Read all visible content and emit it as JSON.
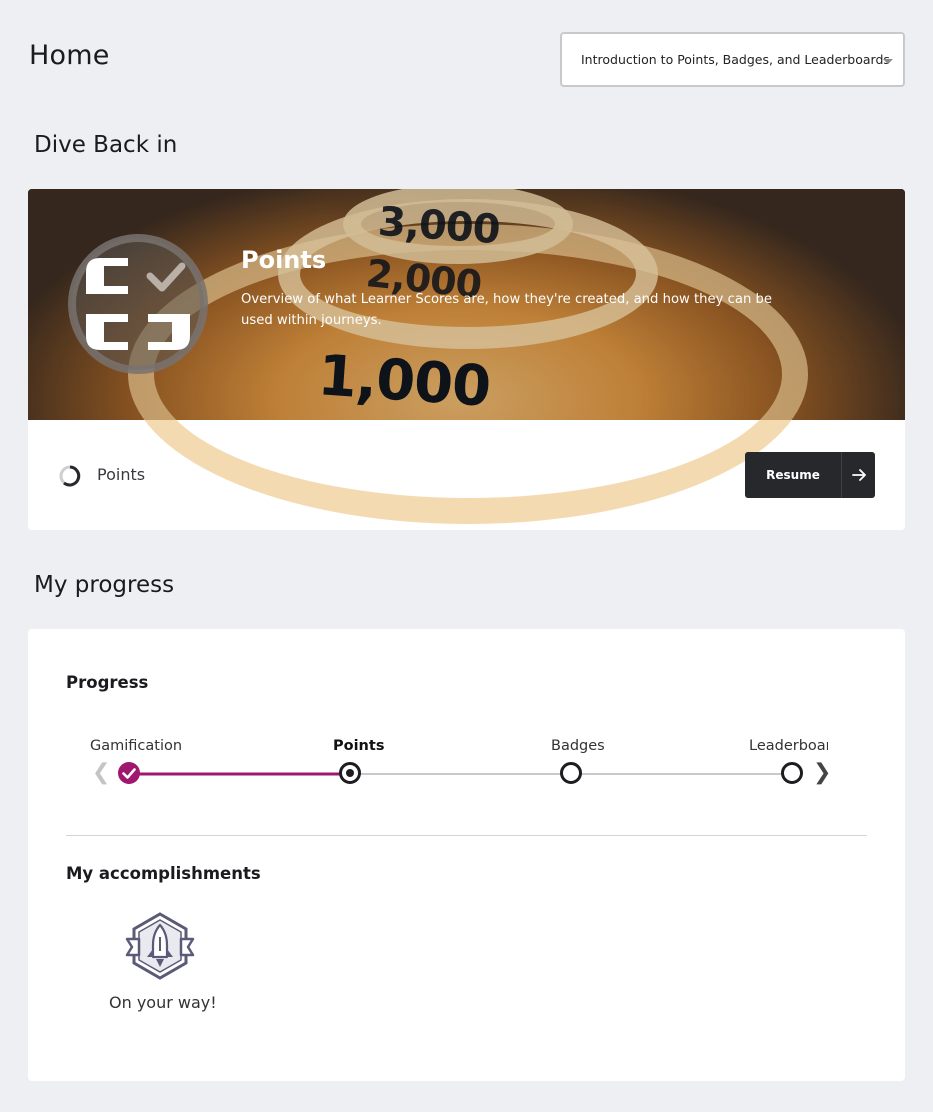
{
  "header": {
    "title": "Home",
    "journey_select": "Introduction to Points, Badges, and Leaderboards"
  },
  "dive_back": {
    "section_title": "Dive Back in",
    "hero_title": "Points",
    "hero_description": "Overview of what Learner Scores are, how they're created, and how they can be used within journeys.",
    "hero_image_numbers": [
      "3,000",
      "2,000",
      "1,000"
    ],
    "status_label": "Points",
    "resume_label": "Resume"
  },
  "progress": {
    "section_title": "My progress",
    "subtitle": "Progress",
    "steps": [
      {
        "label": "Gamification",
        "state": "completed"
      },
      {
        "label": "Points",
        "state": "current"
      },
      {
        "label": "Badges",
        "state": "upcoming"
      },
      {
        "label": "Leaderboards",
        "state": "upcoming"
      }
    ],
    "accomplishments_title": "My accomplishments",
    "badge_label": "On your way!"
  },
  "colors": {
    "accent": "#a0176f",
    "dark_button": "#26282c",
    "background": "#eeeff2"
  },
  "icons": {
    "step_done": "check-icon",
    "resume": "arrow-right-icon",
    "badge": "rocket-badge-icon",
    "prev": "chevron-left-icon",
    "next": "chevron-right-icon"
  }
}
